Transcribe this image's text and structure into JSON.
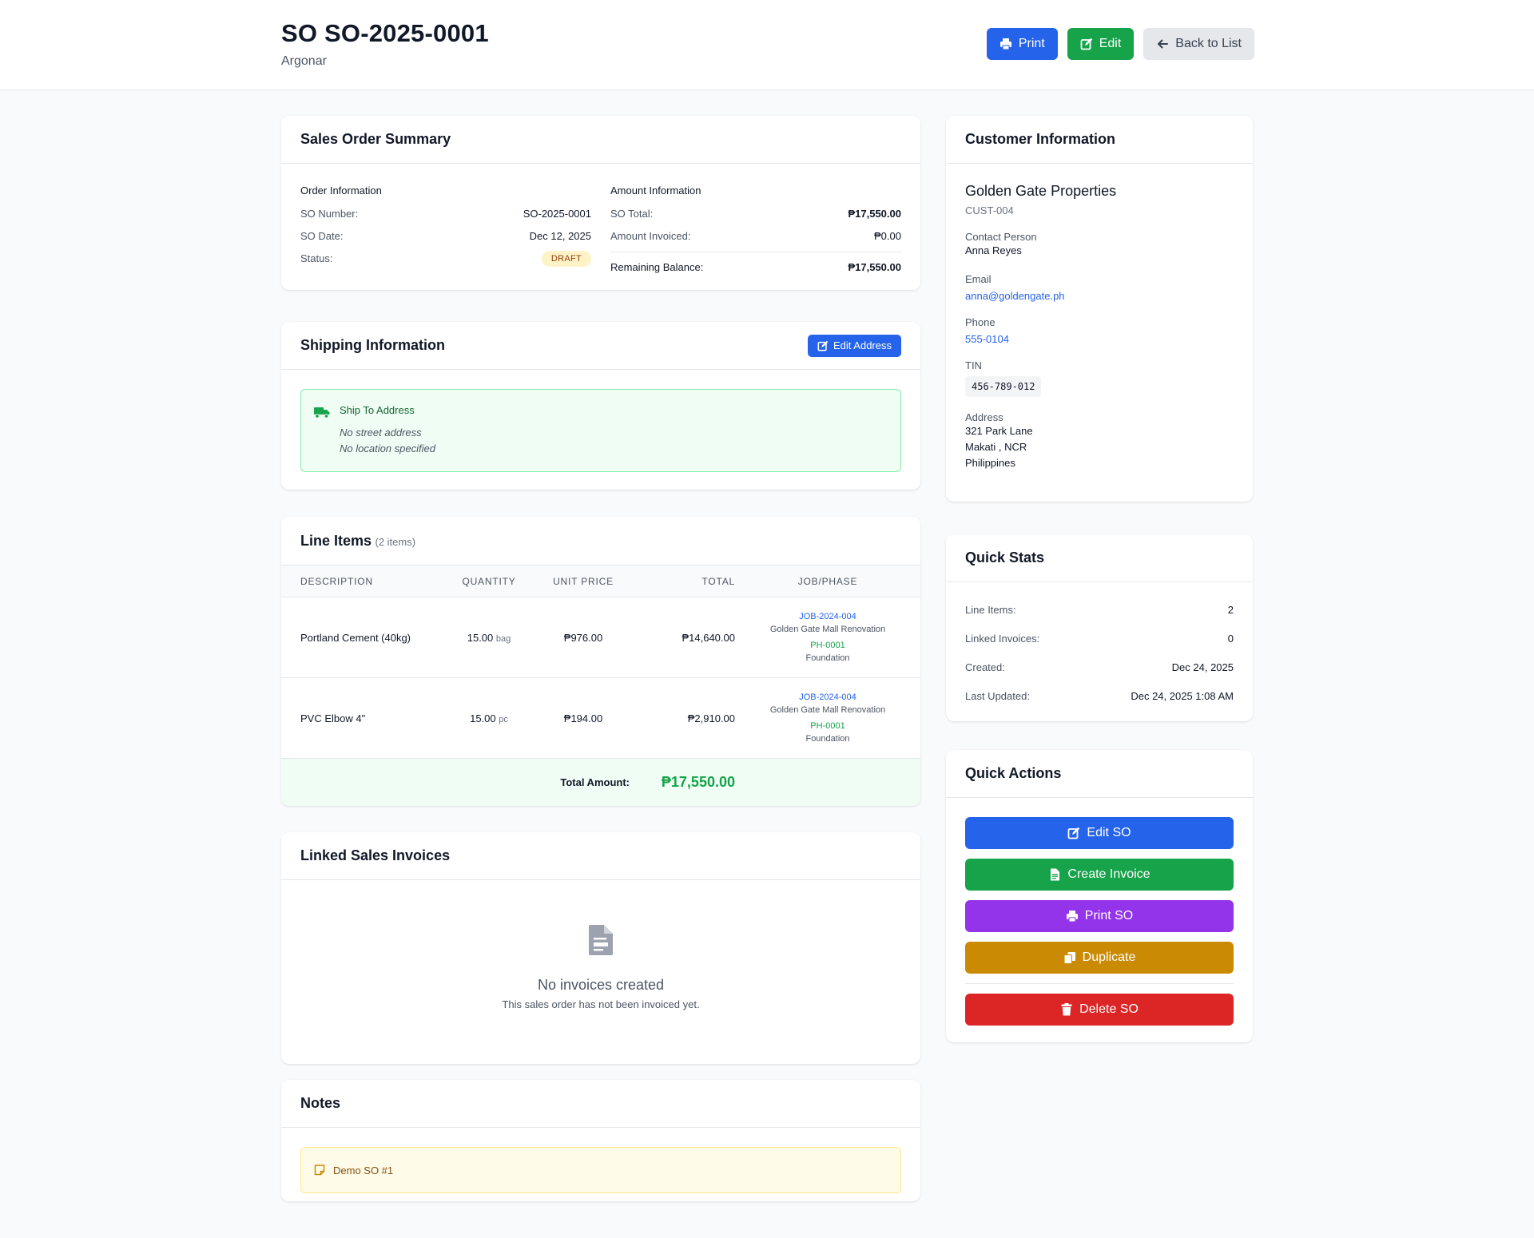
{
  "header": {
    "title": "SO SO-2025-0001",
    "subtitle": "Argonar",
    "print_label": "Print",
    "edit_label": "Edit",
    "back_label": "Back to List"
  },
  "summary": {
    "title": "Sales Order Summary",
    "order_heading": "Order Information",
    "so_number_label": "SO Number:",
    "so_number": "SO-2025-0001",
    "so_date_label": "SO Date:",
    "so_date": "Dec 12, 2025",
    "status_label": "Status:",
    "status": "DRAFT",
    "amount_heading": "Amount Information",
    "total_label": "SO Total:",
    "total": "₱17,550.00",
    "invoiced_label": "Amount Invoiced:",
    "invoiced": "₱0.00",
    "balance_label": "Remaining Balance:",
    "balance": "₱17,550.00"
  },
  "shipping": {
    "title": "Shipping Information",
    "edit_label": "Edit Address",
    "ship_to": "Ship To Address",
    "street": "No street address",
    "location": "No location specified"
  },
  "line_items": {
    "title": "Line Items",
    "count": "(2 items)",
    "columns": {
      "description": "DESCRIPTION",
      "quantity": "QUANTITY",
      "unit_price": "UNIT PRICE",
      "total": "TOTAL",
      "job_phase": "JOB/PHASE"
    },
    "rows": [
      {
        "description": "Portland Cement (40kg)",
        "qty": "15.00",
        "unit": "bag",
        "unit_price": "₱976.00",
        "total": "₱14,640.00",
        "job_code": "JOB-2024-004",
        "job_name": "Golden Gate Mall Renovation",
        "phase_code": "PH-0001",
        "phase_name": "Foundation"
      },
      {
        "description": "PVC Elbow 4\"",
        "qty": "15.00",
        "unit": "pc",
        "unit_price": "₱194.00",
        "total": "₱2,910.00",
        "job_code": "JOB-2024-004",
        "job_name": "Golden Gate Mall Renovation",
        "phase_code": "PH-0001",
        "phase_name": "Foundation"
      }
    ],
    "total_label": "Total Amount:",
    "total_value": "₱17,550.00"
  },
  "invoices": {
    "title": "Linked Sales Invoices",
    "empty_title": "No invoices created",
    "empty_sub": "This sales order has not been invoiced yet."
  },
  "notes": {
    "title": "Notes",
    "text": "Demo SO #1"
  },
  "customer": {
    "title": "Customer Information",
    "name": "Golden Gate Properties",
    "code": "CUST-004",
    "contact_label": "Contact Person",
    "contact": "Anna Reyes",
    "email_label": "Email",
    "email": "anna@goldengate.ph",
    "phone_label": "Phone",
    "phone": "555-0104",
    "tin_label": "TIN",
    "tin": "456-789-012",
    "address_label": "Address",
    "address_line1": "321 Park Lane",
    "address_line2": "Makati , NCR",
    "address_line3": "Philippines"
  },
  "stats": {
    "title": "Quick Stats",
    "line_items_label": "Line Items:",
    "line_items": "2",
    "linked_invoices_label": "Linked Invoices:",
    "linked_invoices": "0",
    "created_label": "Created:",
    "created": "Dec 24, 2025",
    "updated_label": "Last Updated:",
    "updated": "Dec 24, 2025 1:08 AM"
  },
  "quick_actions": {
    "title": "Quick Actions",
    "edit": "Edit SO",
    "invoice": "Create Invoice",
    "print": "Print SO",
    "duplicate": "Duplicate",
    "delete": "Delete SO"
  },
  "colors": {
    "primary": "#2563eb",
    "success": "#16a34a",
    "purple": "#9333ea",
    "amber": "#ca8a04",
    "danger": "#dc2626"
  },
  "icons": {
    "print": "print-icon",
    "edit": "edit-icon",
    "back": "arrow-left-icon",
    "truck": "truck-icon",
    "document": "document-icon",
    "note": "sticky-note-icon",
    "duplicate": "copy-icon",
    "delete": "trash-icon"
  }
}
